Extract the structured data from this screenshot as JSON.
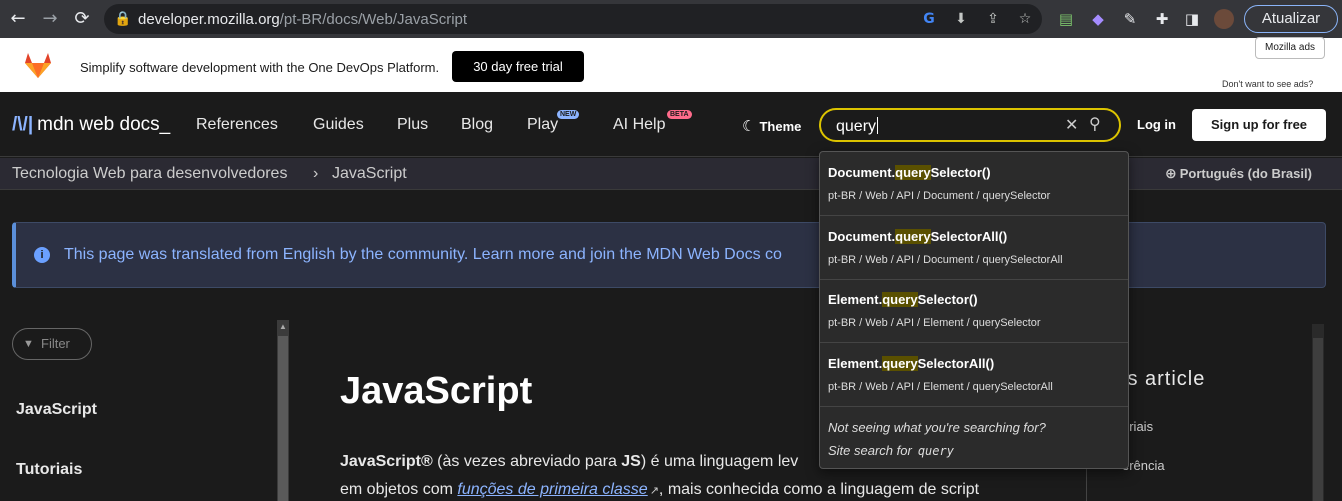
{
  "browser": {
    "back_icon": "arrow-left-icon",
    "forward_icon": "arrow-right-icon",
    "reload_icon": "reload-icon",
    "url_host": "developer.mozilla.org",
    "url_path": "/pt-BR/docs/Web/JavaScript",
    "update_label": "Atualizar"
  },
  "ad": {
    "text": "Simplify software development with the One DevOps Platform.",
    "trial_button": "30 day free trial",
    "badge": "Mozilla ads",
    "dont_want": "Don't want to see ads?"
  },
  "header": {
    "logo_text": "mdn web docs_",
    "nav": [
      {
        "label": "References"
      },
      {
        "label": "Guides"
      },
      {
        "label": "Plus"
      },
      {
        "label": "Blog"
      },
      {
        "label": "Play",
        "badge": "NEW"
      },
      {
        "label": "AI Help",
        "badge": "BETA"
      }
    ],
    "theme_label": "Theme",
    "search_value": "query",
    "login_label": "Log in",
    "signup_label": "Sign up for free"
  },
  "breadcrumb": {
    "items": [
      "Tecnologia Web para desenvolvedores",
      "JavaScript"
    ],
    "separator": "›",
    "language": "Português (do Brasil)"
  },
  "notice": {
    "text": "This page was translated from English by the community. Learn more and join the MDN Web Docs co"
  },
  "sidebar": {
    "filter_placeholder": "Filter",
    "items": [
      "JavaScript",
      "Tutoriais"
    ]
  },
  "main": {
    "title": "JavaScript",
    "intro_bold1": "JavaScript®",
    "intro_part1": " (às vezes abreviado para ",
    "intro_bold2": "JS",
    "intro_part2": ") é uma linguagem lev",
    "intro2_part1": "em objetos com ",
    "intro2_link": "funções de primeira classe",
    "intro2_part2": ", mais conhecida como a linguagem de script"
  },
  "toc": {
    "title": "is article",
    "items": [
      "oriais",
      "erência"
    ]
  },
  "dropdown": {
    "results": [
      {
        "pre": "Document.",
        "hl": "query",
        "post": "Selector()",
        "path": "pt-BR / Web / API / Document / querySelector"
      },
      {
        "pre": "Document.",
        "hl": "query",
        "post": "SelectorAll()",
        "path": "pt-BR / Web / API / Document / querySelectorAll"
      },
      {
        "pre": "Element.",
        "hl": "query",
        "post": "Selector()",
        "path": "pt-BR / Web / API / Element / querySelector"
      },
      {
        "pre": "Element.",
        "hl": "query",
        "post": "SelectorAll()",
        "path": "pt-BR / Web / API / Element / querySelectorAll"
      }
    ],
    "not_seeing": "Not seeing what you're searching for?",
    "site_search_label": "Site search for",
    "site_search_query": "query"
  },
  "colors": {
    "accent_blue": "#8cb4ff",
    "search_border": "#dcc400",
    "highlight": "#5a5000",
    "new_badge": "#8cb4ff",
    "beta_badge": "#ff6b8b"
  }
}
